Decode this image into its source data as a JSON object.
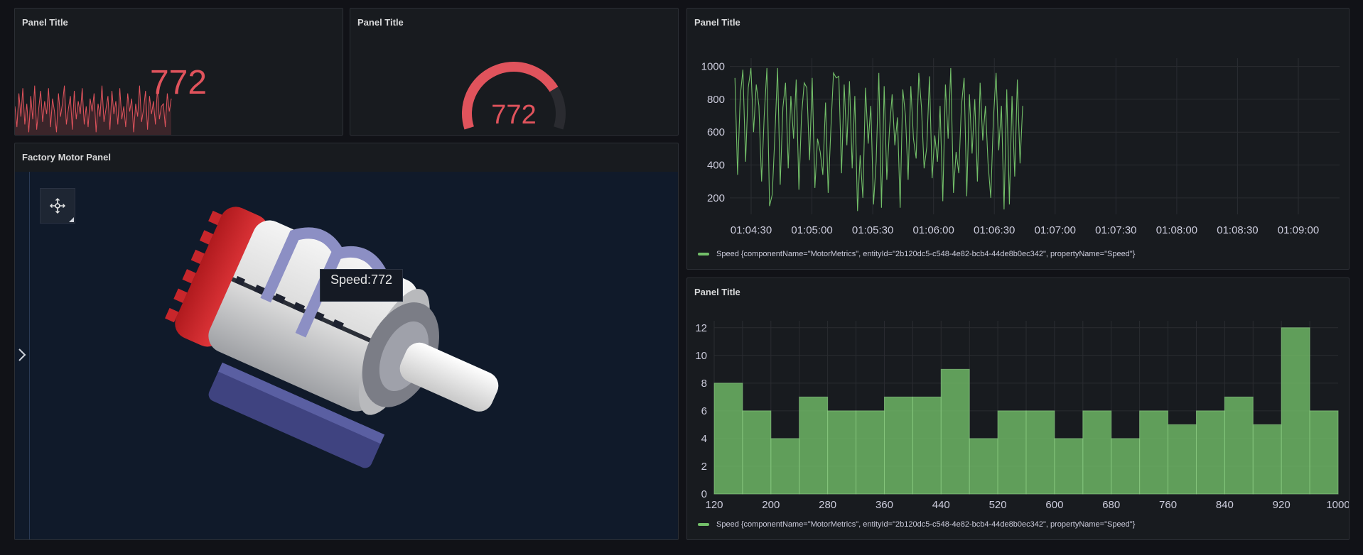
{
  "panels": {
    "stat": {
      "title": "Panel Title",
      "value": "772",
      "color": "#e0535c",
      "sparkline": [
        0.55,
        0.15,
        0.8,
        0.35,
        0.9,
        0.2,
        0.6,
        0.05,
        0.75,
        0.3,
        0.95,
        0.1,
        0.5,
        0.85,
        0.25,
        0.65,
        0.4,
        0.9,
        0.15,
        0.7,
        0.45,
        0.05,
        0.8,
        0.35,
        0.6,
        0.95,
        0.2,
        0.5,
        0.75,
        0.1,
        0.85,
        0.3,
        0.65,
        0.4,
        0.9,
        0.2,
        0.55,
        0.15,
        0.7,
        0.45,
        0.8,
        0.05,
        0.6,
        0.35,
        0.95,
        0.25,
        0.5,
        0.75,
        0.1,
        0.85,
        0.4,
        0.65,
        0.2,
        0.9,
        0.3,
        0.55,
        0.15,
        0.8,
        0.45,
        0.7,
        0.05,
        0.6,
        0.35,
        0.95,
        0.25,
        0.5,
        0.85,
        0.1,
        0.75,
        0.4,
        0.65,
        0.2,
        0.9,
        0.3,
        0.55,
        0.6,
        0.15,
        0.8,
        0.45,
        0.7
      ]
    },
    "gauge": {
      "title": "Panel Title",
      "value": "772",
      "fraction": 0.772,
      "color": "#e0535c",
      "track_color": "#2a2b30"
    },
    "motor": {
      "title": "Factory Motor Panel",
      "tooltip": "Speed:772",
      "nav_icon": "move-icon",
      "expand_icon": "chevron-right-icon"
    },
    "timeseries": {
      "title": "Panel Title",
      "legend": "Speed {componentName=\"MotorMetrics\", entityId=\"2b120dc5-c548-4e82-bcb4-44de8b0ec342\", propertyName=\"Speed\"}"
    },
    "histogram": {
      "title": "Panel Title",
      "legend": "Speed {componentName=\"MotorMetrics\", entityId=\"2b120dc5-c548-4e82-bcb4-44de8b0ec342\", propertyName=\"Speed\"}"
    }
  },
  "chart_data": [
    {
      "type": "line",
      "series": [
        {
          "name": "Speed {componentName=\"MotorMetrics\", entityId=\"2b120dc5-c548-4e82-bcb4-44de8b0ec342\", propertyName=\"Speed\"}",
          "color": "#73bf69",
          "values": [
            930,
            340,
            820,
            980,
            420,
            870,
            990,
            600,
            890,
            760,
            300,
            700,
            990,
            150,
            220,
            580,
            990,
            280,
            750,
            900,
            380,
            820,
            560,
            920,
            250,
            700,
            900,
            870,
            430,
            930,
            260,
            560,
            480,
            340,
            780,
            230,
            620,
            960,
            930,
            940,
            350,
            890,
            520,
            910,
            380,
            820,
            120,
            460,
            200,
            870,
            530,
            760,
            160,
            420,
            960,
            140,
            880,
            310,
            620,
            830,
            520,
            690,
            140,
            860,
            700,
            310,
            880,
            560,
            440,
            960,
            750,
            380,
            510,
            940,
            320,
            580,
            420,
            760,
            180,
            890,
            560,
            990,
            230,
            480,
            350,
            760,
            930,
            210,
            830,
            470,
            800,
            300,
            900,
            550,
            760,
            410,
            200,
            680,
            960,
            490,
            760,
            130,
            860,
            160,
            820,
            330,
            920,
            410,
            760
          ]
        }
      ],
      "x_start": "01:04:22",
      "x_end": "01:06:44",
      "x_ticks": [
        "01:04:30",
        "01:05:00",
        "01:05:30",
        "01:06:00",
        "01:06:30",
        "01:07:00",
        "01:07:30",
        "01:08:00",
        "01:08:30",
        "01:09:00"
      ],
      "y_ticks": [
        200,
        400,
        600,
        800,
        1000
      ],
      "ylim": [
        100,
        1050
      ],
      "grid": true,
      "legend_position": "bottom-left"
    },
    {
      "type": "bar",
      "bin_width": 40,
      "bin_starts": [
        120,
        160,
        200,
        240,
        280,
        320,
        360,
        400,
        440,
        480,
        520,
        560,
        600,
        640,
        680,
        720,
        760,
        800,
        840,
        880,
        920,
        960
      ],
      "values": [
        8,
        6,
        4,
        7,
        6,
        6,
        7,
        7,
        9,
        4,
        6,
        6,
        4,
        6,
        4,
        6,
        5,
        6,
        7,
        5,
        12,
        6
      ],
      "color": "#73bf69",
      "x_ticks": [
        "120",
        "200",
        "280",
        "360",
        "440",
        "520",
        "600",
        "680",
        "760",
        "840",
        "920",
        "1000"
      ],
      "y_ticks": [
        0,
        2,
        4,
        6,
        8,
        10,
        12
      ],
      "ylim": [
        0,
        12.5
      ],
      "grid": true,
      "legend_position": "bottom-left"
    }
  ]
}
